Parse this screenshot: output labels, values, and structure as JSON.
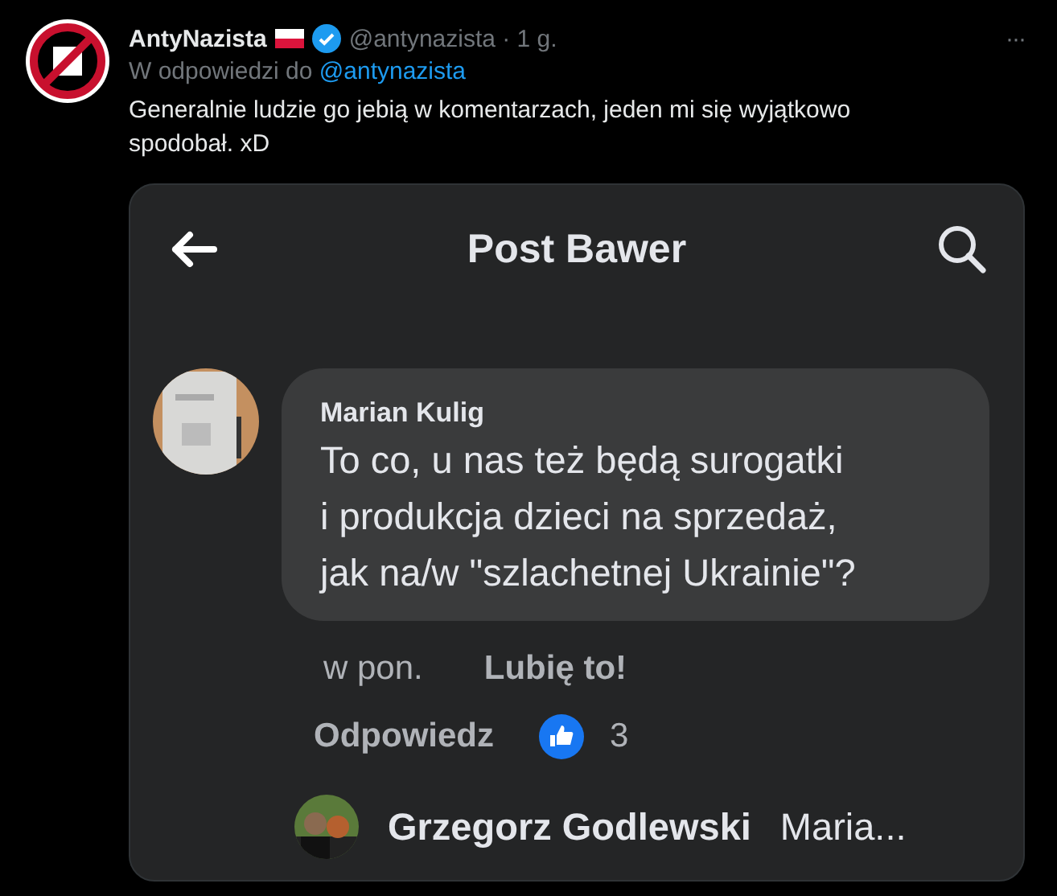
{
  "tweet": {
    "author": "AntyNazista",
    "handle_time": "@antynazista · 1 g.",
    "reply_prefix": "W odpowiedzi do",
    "reply_to": "@antynazista",
    "text": "Generalnie ludzie go jebią w komentarzach, jeden mi się wyjątkowo spodobał. xD",
    "more": "···"
  },
  "screenshot": {
    "title": "Post Bawer",
    "comment": {
      "author": "Marian Kulig",
      "text_lines": [
        "To co, u nas też będą surogatki",
        "i produkcja dzieci na sprzedaż,",
        "jak na/w \"szlachetnej Ukrainie\"?"
      ],
      "time": "w pon.",
      "like": "Lubię to!",
      "reply": "Odpowiedz",
      "reactions": "3"
    },
    "reply_preview": {
      "author": "Grzegorz Godlewski",
      "text": "Maria..."
    }
  }
}
